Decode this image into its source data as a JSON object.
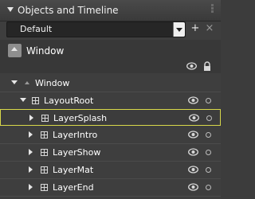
{
  "panel": {
    "title": "Objects and Timeline"
  },
  "toolbar": {
    "storyboard_value": "Default",
    "add_button": "+",
    "close_button": "×"
  },
  "scope": {
    "label": "Window"
  },
  "tree": {
    "root": "Window",
    "layout_root": "LayoutRoot",
    "items": [
      {
        "label": "LayerSplash",
        "selected": true
      },
      {
        "label": "LayerIntro",
        "selected": false
      },
      {
        "label": "LayerShow",
        "selected": false
      },
      {
        "label": "LayerMat",
        "selected": false
      },
      {
        "label": "LayerEnd",
        "selected": false
      }
    ]
  },
  "colors": {
    "selection_border": "#d8d84a",
    "panel_background": "#3e3e3e",
    "text": "#ffffff"
  },
  "icons": {
    "visibility": "eye-icon",
    "lock": "lock-icon",
    "layer": "grid-icon",
    "window": "window-icon"
  }
}
